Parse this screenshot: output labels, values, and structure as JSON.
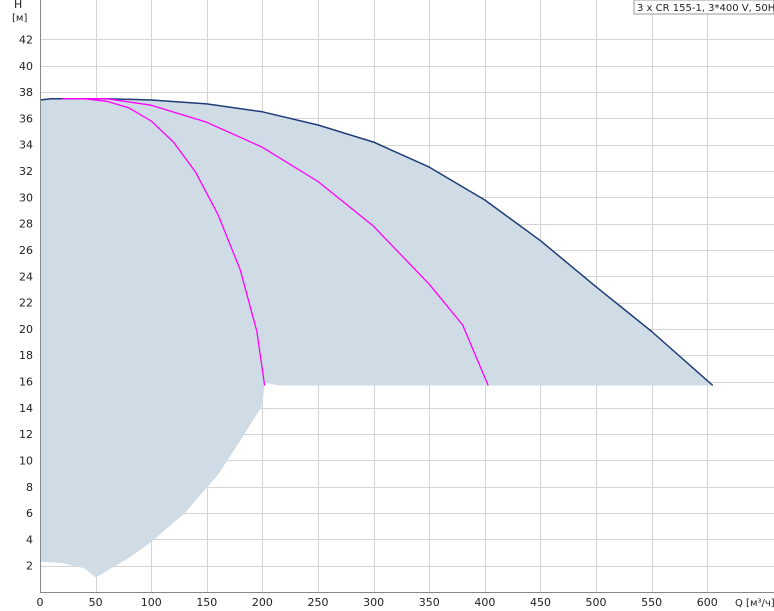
{
  "chart_data": {
    "type": "area",
    "title": "3 x CR 155-1, 3*400 V, 50Hz",
    "ylabel": "H",
    "yunit": "[м]",
    "xlabel": "Q [м³/ч]",
    "xlim": [
      0,
      660
    ],
    "ylim": [
      0,
      45
    ],
    "xticks": [
      0,
      50,
      100,
      150,
      200,
      250,
      300,
      350,
      400,
      450,
      500,
      550,
      600
    ],
    "yticks": [
      2,
      4,
      6,
      8,
      10,
      12,
      14,
      16,
      18,
      20,
      22,
      24,
      26,
      28,
      30,
      32,
      34,
      36,
      38,
      40,
      42
    ],
    "grid": true,
    "colors": {
      "area": "#cfdbe5",
      "max_curve": "#1e3c78",
      "partial_curves": "#ff00ff"
    },
    "operating_range": {
      "upper": [
        [
          0,
          37.4
        ],
        [
          10,
          37.5
        ],
        [
          30,
          37.5
        ],
        [
          60,
          37.5
        ],
        [
          100,
          37.4
        ],
        [
          150,
          37.1
        ],
        [
          200,
          36.5
        ],
        [
          250,
          35.5
        ],
        [
          300,
          34.2
        ],
        [
          350,
          32.3
        ],
        [
          400,
          29.8
        ],
        [
          450,
          26.7
        ],
        [
          500,
          23.2
        ],
        [
          550,
          19.8
        ],
        [
          605,
          15.7
        ]
      ],
      "bottom_plateau": 15.7,
      "lower": [
        [
          0,
          2.3
        ],
        [
          20,
          2.2
        ],
        [
          40,
          1.8
        ],
        [
          50,
          1.1
        ],
        [
          60,
          1.6
        ],
        [
          80,
          2.6
        ],
        [
          100,
          3.8
        ],
        [
          130,
          6.0
        ],
        [
          160,
          8.9
        ],
        [
          180,
          11.5
        ],
        [
          200,
          14.2
        ],
        [
          202,
          15.9
        ],
        [
          215,
          15.7
        ]
      ]
    },
    "series": [
      {
        "role": "max",
        "values": [
          [
            0,
            37.4
          ],
          [
            10,
            37.5
          ],
          [
            30,
            37.5
          ],
          [
            60,
            37.5
          ],
          [
            100,
            37.4
          ],
          [
            150,
            37.1
          ],
          [
            200,
            36.5
          ],
          [
            250,
            35.5
          ],
          [
            300,
            34.2
          ],
          [
            350,
            32.3
          ],
          [
            400,
            29.8
          ],
          [
            450,
            26.7
          ],
          [
            500,
            23.2
          ],
          [
            550,
            19.8
          ],
          [
            605,
            15.7
          ]
        ]
      },
      {
        "role": "partial",
        "values": [
          [
            20,
            37.5
          ],
          [
            40,
            37.5
          ],
          [
            60,
            37.3
          ],
          [
            80,
            36.8
          ],
          [
            100,
            35.8
          ],
          [
            120,
            34.2
          ],
          [
            140,
            31.9
          ],
          [
            160,
            28.7
          ],
          [
            180,
            24.5
          ],
          [
            195,
            19.8
          ],
          [
            202,
            15.7
          ]
        ]
      },
      {
        "role": "partial",
        "values": [
          [
            30,
            37.5
          ],
          [
            60,
            37.5
          ],
          [
            100,
            37.0
          ],
          [
            150,
            35.7
          ],
          [
            200,
            33.8
          ],
          [
            250,
            31.2
          ],
          [
            300,
            27.8
          ],
          [
            350,
            23.4
          ],
          [
            380,
            20.3
          ],
          [
            403,
            15.7
          ]
        ]
      }
    ]
  }
}
